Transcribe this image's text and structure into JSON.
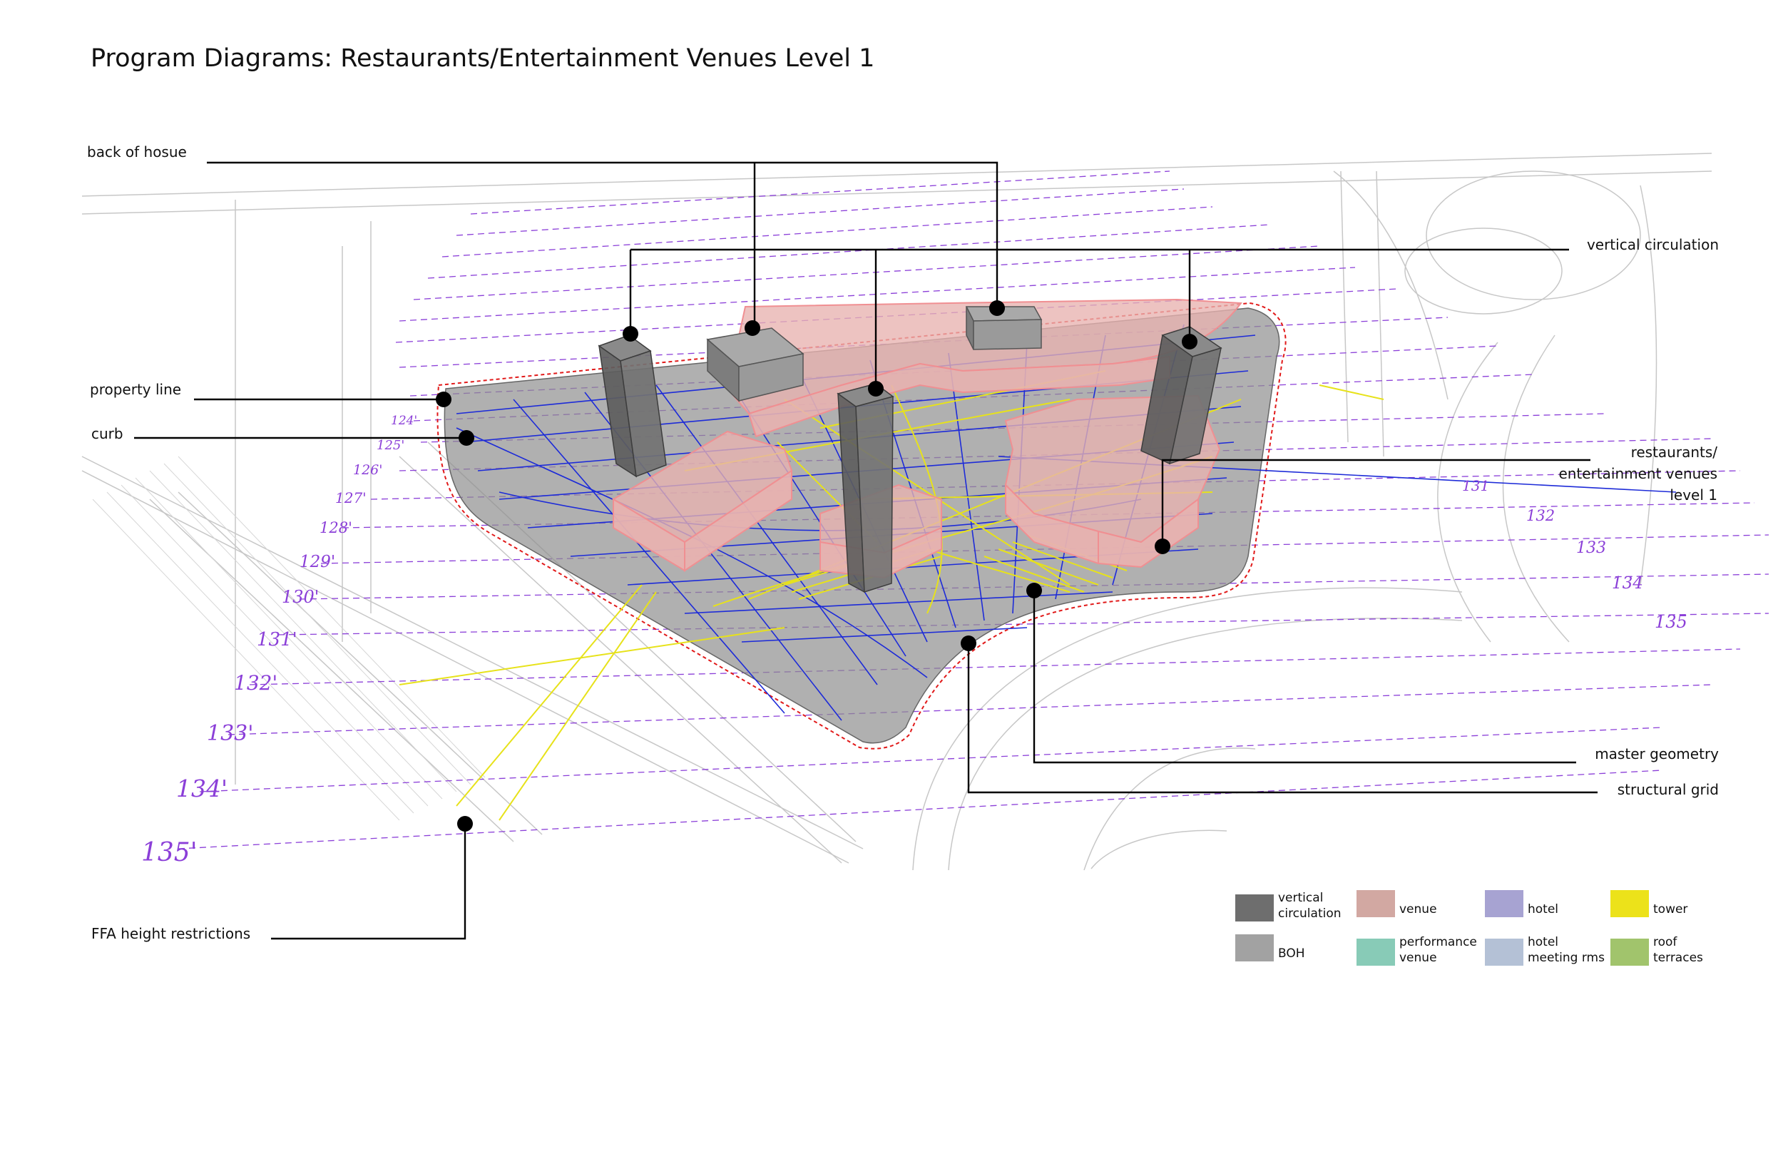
{
  "title": "Program Diagrams: Restaurants/Entertainment Venues Level 1",
  "callouts": {
    "back_of_house": "back of hosue",
    "vertical_circulation": "vertical circulation",
    "property_line": "property line",
    "curb": "curb",
    "restaurants": "restaurants/\nentertainment venues\nlevel 1",
    "master_geometry": "master geometry",
    "structural_grid": "structural grid",
    "ffa_height": "FFA height restrictions"
  },
  "elevation_labels": [
    "124'",
    "125'",
    "126'",
    "127'",
    "128'",
    "129'",
    "130'",
    "131'",
    "132'",
    "133'",
    "134'",
    "135'"
  ],
  "right_elevation_labels": [
    "131",
    "132",
    "133",
    "134",
    "135"
  ],
  "legend": [
    {
      "label": "vertical\ncirculation",
      "color": "#6e6e6e"
    },
    {
      "label": "venue",
      "color": "#d2a8a2"
    },
    {
      "label": "hotel",
      "color": "#a7a3d2"
    },
    {
      "label": "tower",
      "color": "#ece21a"
    },
    {
      "label": "BOH",
      "color": "#a2a2a2"
    },
    {
      "label": "performance\nvenue",
      "color": "#88cbb7"
    },
    {
      "label": "hotel\nmeeting rms",
      "color": "#b4c1d6"
    },
    {
      "label": "roof\nterraces",
      "color": "#a1c46c"
    }
  ],
  "colors": {
    "site_fill": "#8e8e8e",
    "venue_fill": "#e8b2b0",
    "venue_stroke": "#f08f92",
    "grid_blue": "#1d2bd8",
    "grid_yellow": "#e7e21a",
    "height_purple": "#8b3fd8",
    "property_red": "#e11a1a"
  }
}
